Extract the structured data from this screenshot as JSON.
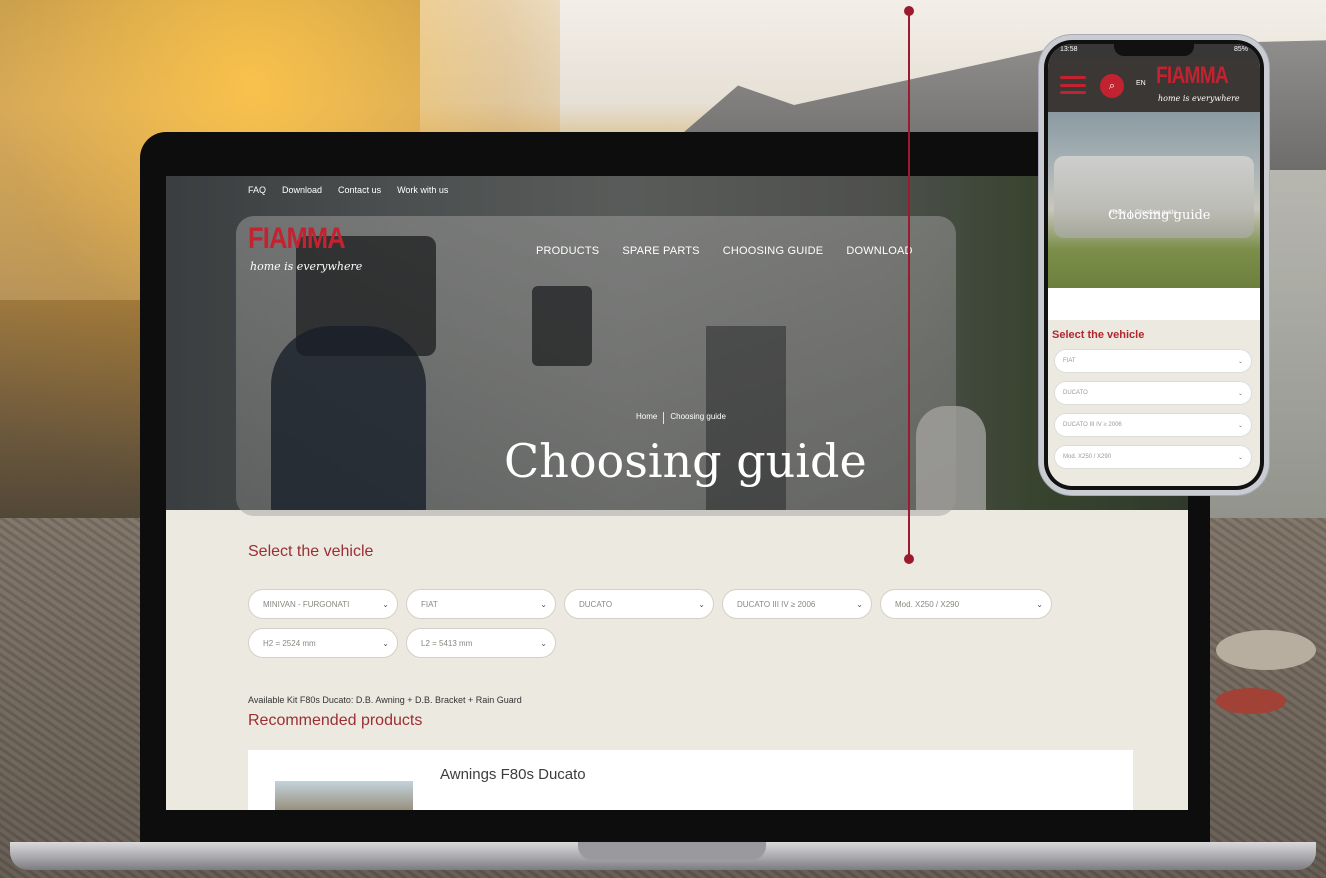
{
  "laptop_site": {
    "topbar": [
      "FAQ",
      "Download",
      "Contact us",
      "Work with us"
    ],
    "brand": {
      "name": "FIAMMA",
      "tagline": "home is everywhere"
    },
    "nav": [
      "PRODUCTS",
      "SPARE PARTS",
      "CHOOSING GUIDE",
      "DOWNLOAD"
    ],
    "breadcrumb": {
      "home": "Home",
      "current": "Choosing guide"
    },
    "hero_title": "Choosing guide",
    "select_title": "Select the vehicle",
    "selects": [
      {
        "value": "MINIVAN - FURGONATI"
      },
      {
        "value": "FIAT"
      },
      {
        "value": "DUCATO"
      },
      {
        "value": "DUCATO III IV ≥ 2006"
      },
      {
        "value": "Mod. X250 / X290"
      },
      {
        "value": "H2 = 2524 mm"
      },
      {
        "value": "L2 = 5413 mm"
      }
    ],
    "available_kit": "Available Kit F80s Ducato: D.B. Awning + D.B. Bracket + Rain Guard",
    "recommended_title": "Recommended products",
    "product": {
      "title": "Awnings F80s Ducato"
    }
  },
  "phone_site": {
    "status_time": "13:58",
    "status_right": "85%",
    "lang": "EN",
    "brand": {
      "name": "FIAMMA",
      "tagline": "home is everywhere"
    },
    "breadcrumb": {
      "home": "Home",
      "current": "Choosing guide"
    },
    "hero_title": "Choosing guide",
    "select_title": "Select the vehicle",
    "selects": [
      {
        "value": "FIAT"
      },
      {
        "value": "DUCATO"
      },
      {
        "value": "DUCATO III IV ≥ 2006"
      },
      {
        "value": "Mod. X250 / X290"
      }
    ]
  },
  "colors": {
    "accent": "#c32230",
    "heading": "#9b2f33",
    "callout": "#9b1b2c"
  },
  "icons": {
    "dropdown": "chevron-down-icon",
    "search": "search-icon",
    "menu": "hamburger-icon"
  }
}
